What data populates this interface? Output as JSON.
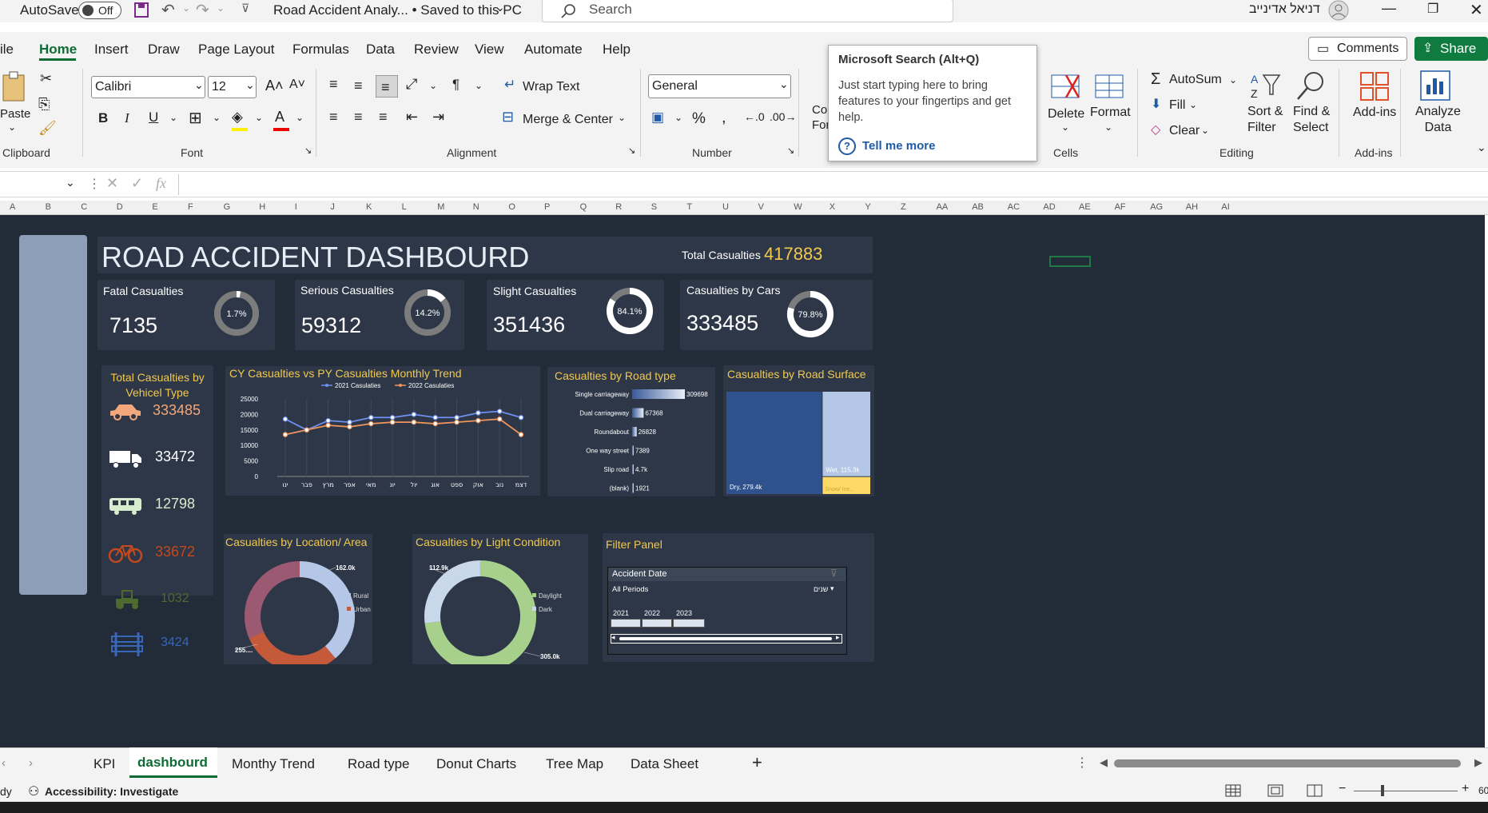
{
  "titlebar": {
    "autosave_label": "AutoSave",
    "autosave_state": "Off",
    "doc_title": "Road Accident Analy...  •  Saved to this PC",
    "search_placeholder": "Search",
    "user_name": "דניאל אדינייב"
  },
  "menu_tabs": [
    "ile",
    "Home",
    "Insert",
    "Draw",
    "Page Layout",
    "Formulas",
    "Data",
    "Review",
    "View",
    "Automate",
    "Help"
  ],
  "ribbon": {
    "comments": "Comments",
    "share": "Share",
    "paste": "Paste",
    "clipboard": "Clipboard",
    "font_name": "Calibri",
    "font_size": "12",
    "font_group": "Font",
    "wrap_text": "Wrap Text",
    "merge_center": "Merge & Center",
    "alignment_group": "Alignment",
    "number_format": "General",
    "number_group": "Number",
    "cond_format": "Co\nFor",
    "delete": "Delete",
    "format": "Format",
    "cells_group": "Cells",
    "autosum": "AutoSum",
    "fill": "Fill",
    "clear": "Clear",
    "sort_filter": "Sort &\nFilter",
    "find_select": "Find &\nSelect",
    "editing_group": "Editing",
    "add_ins": "Add-ins",
    "add_ins_group": "Add-ins",
    "analyze_data": "Analyze\nData"
  },
  "tooltip": {
    "title": "Microsoft Search (Alt+Q)",
    "body": "Just start typing here to bring features to your fingertips and get help.",
    "link": "Tell me more"
  },
  "columns": [
    "A",
    "B",
    "C",
    "D",
    "E",
    "F",
    "G",
    "H",
    "I",
    "J",
    "K",
    "L",
    "M",
    "N",
    "O",
    "P",
    "Q",
    "R",
    "S",
    "T",
    "U",
    "V",
    "W",
    "X",
    "Y",
    "Z",
    "AA",
    "AB",
    "AC",
    "AD",
    "AE",
    "AF",
    "AG",
    "AH",
    "AI"
  ],
  "dashboard": {
    "title": "ROAD ACCIDENT DASHBOURD",
    "total_label": "Total Casualties",
    "total_value": "417883",
    "kpis": [
      {
        "label": "Fatal Casualties",
        "value": "7135",
        "pct": "1.7%",
        "frac": 0.017
      },
      {
        "label": "Serious Casualties",
        "value": "59312",
        "pct": "14.2%",
        "frac": 0.142
      },
      {
        "label": "Slight Casualties",
        "value": "351436",
        "pct": "84.1%",
        "frac": 0.841
      },
      {
        "label": "Casualties by Cars",
        "value": "333485",
        "pct": "79.8%",
        "frac": 0.798
      }
    ],
    "vehicle_title": "Total Casualties by Vehicel Type",
    "vehicles": [
      {
        "icon": "car-icon",
        "value": "333485",
        "color": "#f4a77a"
      },
      {
        "icon": "truck-icon",
        "value": "33472",
        "color": "#ffffff"
      },
      {
        "icon": "bus-icon",
        "value": "12798",
        "color": "#d7eccf"
      },
      {
        "icon": "bicycle-icon",
        "value": "33672",
        "color": "#c4491d"
      },
      {
        "icon": "tractor-icon",
        "value": "1032",
        "color": "#4d6b2e"
      },
      {
        "icon": "barrier-icon",
        "value": "3424",
        "color": "#3a66b8"
      }
    ],
    "filter_title": "Filter Panel",
    "slicer": {
      "title": "Accident Date",
      "period": "All Periods",
      "unit": "שנים",
      "years": [
        "2021",
        "2022",
        "2023"
      ]
    }
  },
  "chart_data": [
    {
      "type": "line",
      "title": "CY Casualties vs PY Casualties Monthly Trend",
      "categories": [
        "ינו",
        "פבר",
        "מרץ",
        "אפר",
        "מאי",
        "יונ",
        "יול",
        "אוג",
        "ספט",
        "אוק",
        "נוב",
        "דצמ"
      ],
      "series": [
        {
          "name": "2021 Casulaties",
          "values": [
            18500,
            15000,
            18000,
            17500,
            19000,
            19000,
            20000,
            19000,
            19000,
            20500,
            21000,
            19000
          ],
          "color": "#6f8ff0"
        },
        {
          "name": "2022 Casulaties",
          "values": [
            13500,
            15000,
            16500,
            16000,
            17000,
            17500,
            17500,
            17000,
            17500,
            18000,
            18500,
            13500
          ],
          "color": "#f0945a"
        }
      ],
      "y_ticks": [
        "0",
        "5000",
        "10000",
        "15000",
        "20000",
        "25000"
      ],
      "ylim": [
        0,
        25000
      ]
    },
    {
      "type": "bar",
      "title": "Casualties by Road type",
      "categories": [
        "Single carriageway",
        "Dual carriageway",
        "Roundabout",
        "One way street",
        "Slip road",
        "(blank)"
      ],
      "values": [
        309698,
        67368,
        26828,
        7389,
        4700,
        1921
      ],
      "labels": [
        "309698",
        "67368",
        "26828",
        "7389",
        "4.7k",
        "1921"
      ]
    },
    {
      "type": "heatmap",
      "title": "Casualties by Road Surface",
      "categories": [
        "Dry",
        "Wet",
        "Snow/Ice"
      ],
      "values": [
        279400,
        115300,
        23000
      ],
      "labels": [
        "Dry, 279.4k",
        "Wet, 115.3k",
        "Snow/ Ice..."
      ]
    },
    {
      "type": "pie",
      "title": "Casualties by Location/ Area",
      "categories": [
        "Rural",
        "Urban"
      ],
      "values": [
        162000,
        255900
      ],
      "labels": [
        "162.0k",
        "255...."
      ]
    },
    {
      "type": "pie",
      "title": "Casualties by Light Condition",
      "categories": [
        "Daylight",
        "Dark"
      ],
      "values": [
        305000,
        112900
      ],
      "labels": [
        "305.0k",
        "112.9k"
      ]
    }
  ],
  "sheet_tabs": [
    "KPI",
    "dashbourd",
    "Monthy Trend",
    "Road type",
    "Donut Charts",
    "Tree Map",
    "Data Sheet"
  ],
  "status": {
    "ready": "dy",
    "accessibility": "Accessibility: Investigate",
    "zoom": "60"
  }
}
